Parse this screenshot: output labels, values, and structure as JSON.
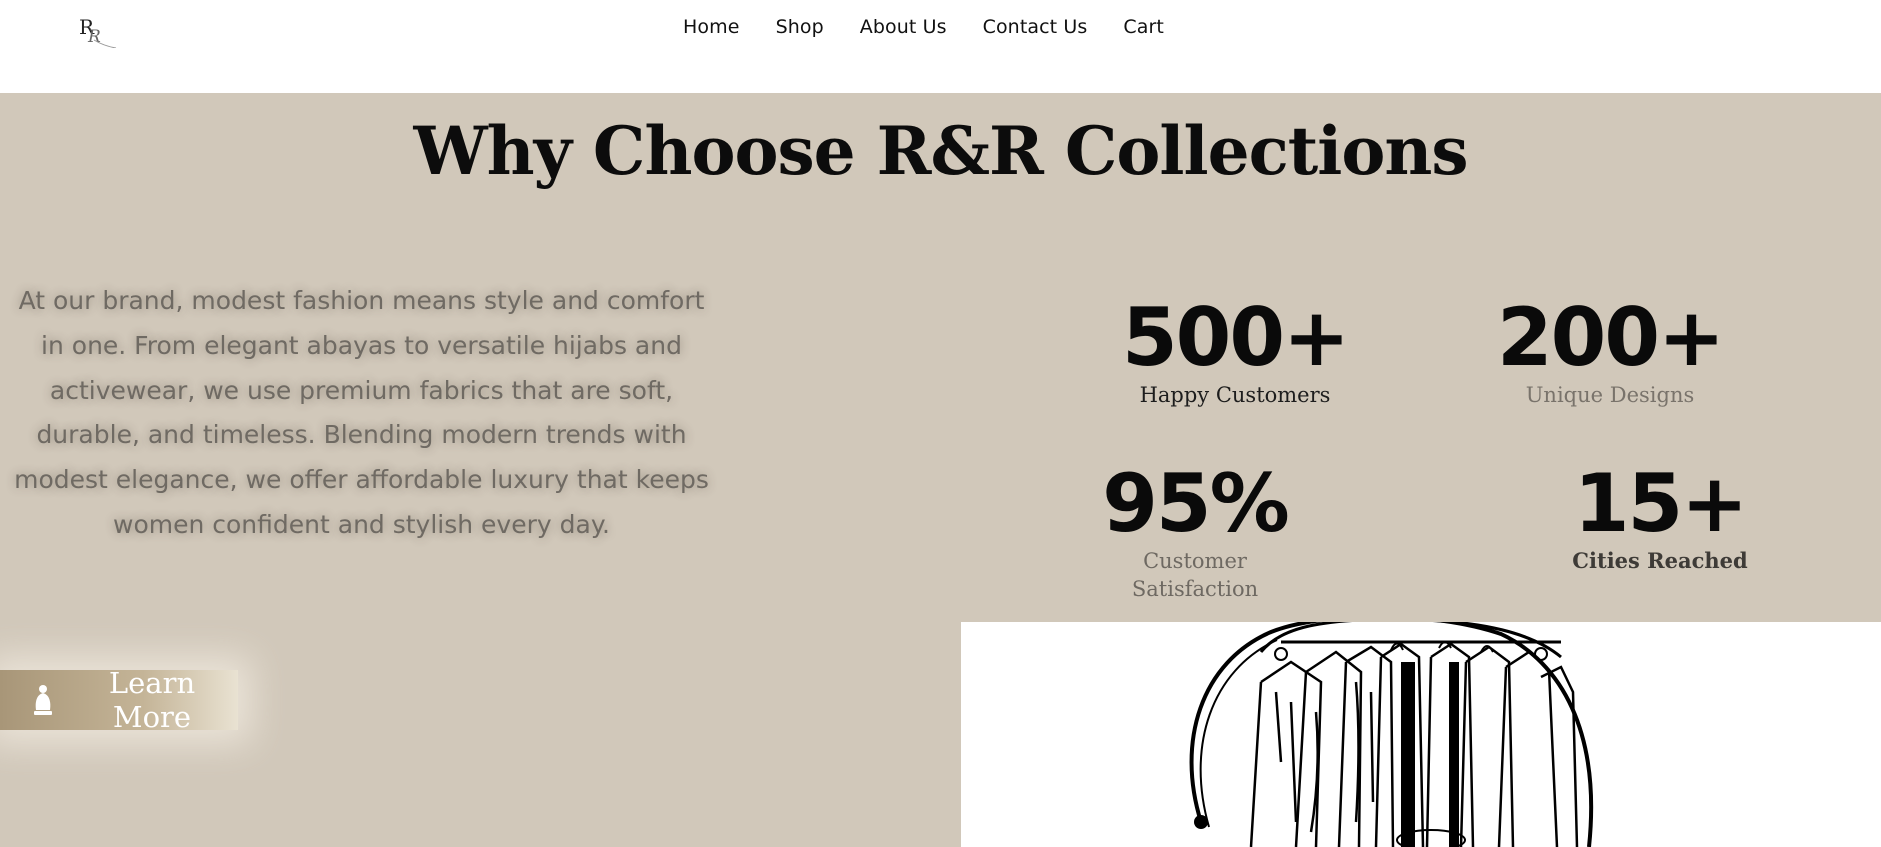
{
  "nav": {
    "logo_text": "R&R",
    "items": [
      "Home",
      "Shop",
      "About Us",
      "Contact Us",
      "Cart"
    ]
  },
  "section": {
    "title": "Why Choose R&R Collections",
    "description": "At our brand, modest fashion means style and comfort in one. From elegant abayas to versatile hijabs and activewear, we use premium fabrics that are soft, durable, and timeless. Blending modern trends with modest elegance, we offer affordable luxury that keeps women confident and stylish every day.",
    "stats": [
      {
        "value": "500+",
        "label": "Happy Customers"
      },
      {
        "value": "200+",
        "label": "Unique Designs"
      },
      {
        "value": "95%",
        "label": "Customer Satisfaction"
      },
      {
        "value": "15+",
        "label": "Cities Reached"
      }
    ],
    "button_label": "Learn More",
    "button_icon": "person-icon",
    "illustration": "clothing-rack-illustration"
  },
  "colors": {
    "section_bg": "#d1c8ba",
    "button_gold": "#a89678",
    "text_dark": "#0c0c0c"
  }
}
